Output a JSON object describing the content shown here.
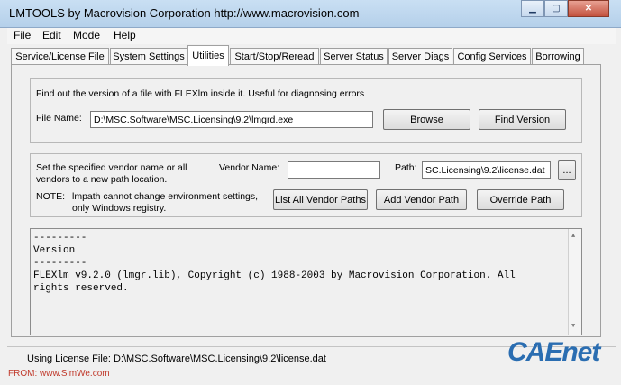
{
  "window": {
    "title": "LMTOOLS by Macrovision Corporation http://www.macrovision.com"
  },
  "window_controls": {
    "minimize": "▁",
    "maximize": "▢",
    "close": "✕"
  },
  "menu": [
    "File",
    "Edit",
    "Mode",
    "Help"
  ],
  "tabs": [
    "Service/License File",
    "System Settings",
    "Utilities",
    "Start/Stop/Reread",
    "Server Status",
    "Server Diags",
    "Config Services",
    "Borrowing"
  ],
  "active_tab": "Utilities",
  "find_version": {
    "description": "Find out the version of a file with FLEXlm inside it.  Useful for diagnosing errors",
    "file_name_label": "File Name:",
    "file_name_value": "D:\\MSC.Software\\MSC.Licensing\\9.2\\lmgrd.exe",
    "browse_label": "Browse",
    "find_version_label": "Find Version"
  },
  "vendor": {
    "description_line1": "Set the specified vendor name or all",
    "description_line2": "vendors to a new path location.",
    "vendor_name_label": "Vendor Name:",
    "vendor_name_value": "",
    "path_label": "Path:",
    "path_value": "SC.Licensing\\9.2\\license.dat",
    "path_browse_label": "...",
    "note_label": "NOTE:",
    "note_line1": "lmpath cannot change environment settings,",
    "note_line2": "only Windows registry.",
    "list_all_label": "List All Vendor Paths",
    "add_vendor_label": "Add Vendor Path",
    "override_label": "Override Path"
  },
  "output": {
    "lines": [
      "---------",
      "Version",
      "---------",
      "FLEXlm v9.2.0 (lmgr.lib), Copyright (c) 1988-2003 by Macrovision Corporation. All",
      "rights reserved."
    ]
  },
  "status": {
    "text": "Using License File:  D:\\MSC.Software\\MSC.Licensing\\9.2\\license.dat"
  },
  "watermark": {
    "logo": "CAEnet",
    "source_prefix": "FROM: ",
    "source_site": "www.SimWe.com"
  }
}
